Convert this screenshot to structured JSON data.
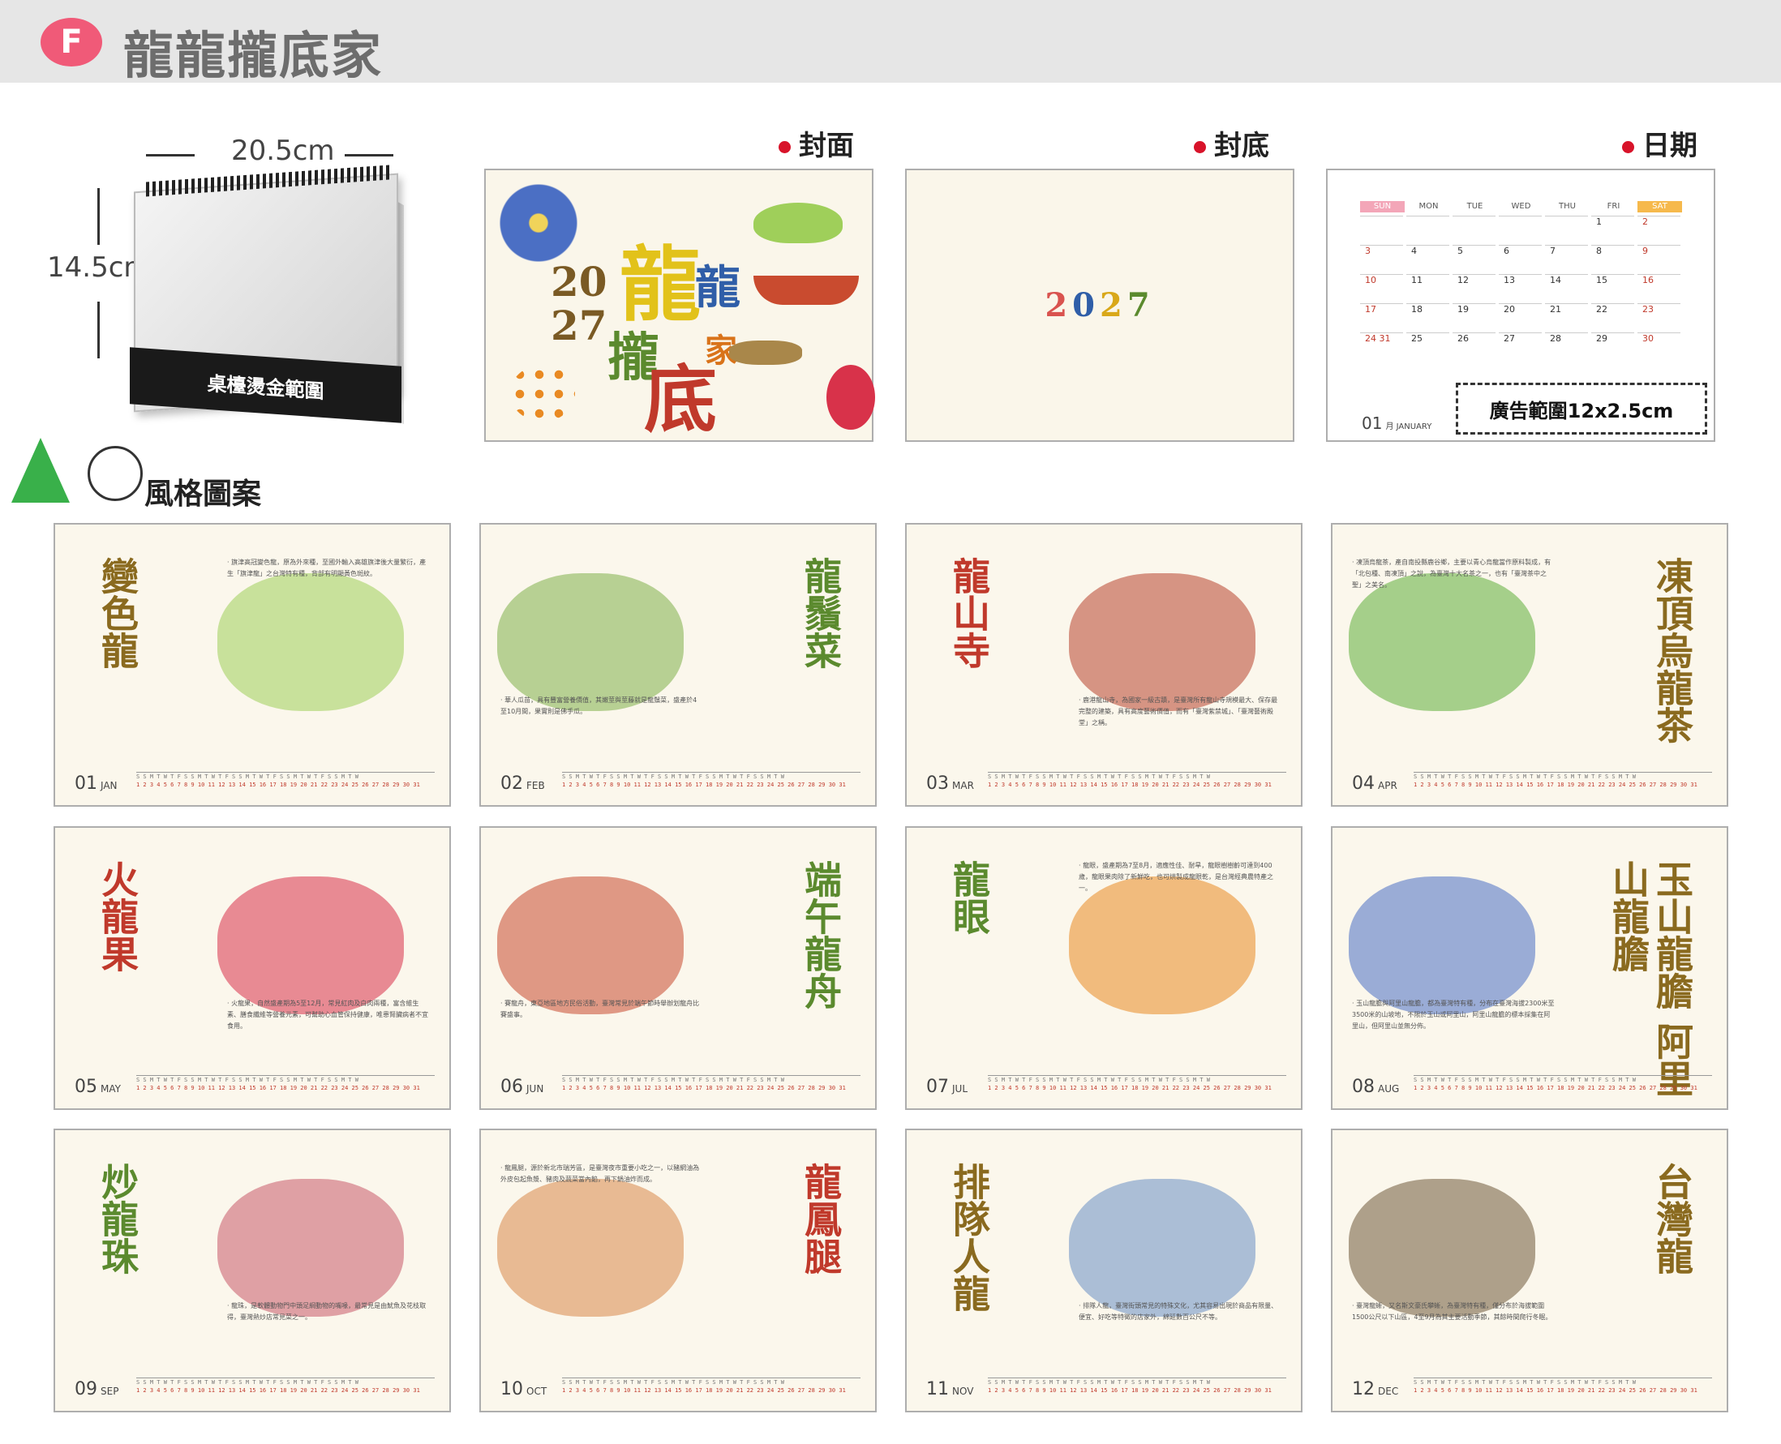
{
  "header": {
    "badge": "F",
    "title": "龍龍攏底家"
  },
  "desk": {
    "width_label": "20.5cm",
    "height_label": "14.5cm",
    "foot_label": "桌檯燙金範圍"
  },
  "sections": {
    "cover": "封面",
    "back": "封底",
    "date": "日期"
  },
  "cover": {
    "year_top": "20",
    "year_bottom": "27",
    "chars": [
      "龍",
      "龍",
      "家",
      "攏",
      "底"
    ]
  },
  "back": {
    "year_digits": [
      "2",
      "0",
      "2",
      "7"
    ]
  },
  "date_page": {
    "weekdays": [
      "SUN",
      "MON",
      "TUE",
      "WED",
      "THU",
      "FRI",
      "SAT"
    ],
    "weeks": [
      [
        "",
        "",
        "",
        "",
        "",
        "1",
        "2"
      ],
      [
        "3",
        "4",
        "5",
        "6",
        "7",
        "8",
        "9"
      ],
      [
        "10",
        "11",
        "12",
        "13",
        "14",
        "15",
        "16"
      ],
      [
        "17",
        "18",
        "19",
        "20",
        "21",
        "22",
        "23"
      ],
      [
        "24 31",
        "25",
        "26",
        "27",
        "28",
        "29",
        "30"
      ]
    ],
    "month_num": "01",
    "month_suffix": "月 JANUARY",
    "ad_label": "廣告範圍12x2.5cm"
  },
  "style_label": "風格圖案",
  "months": [
    {
      "num": "01",
      "abbr": "JAN",
      "title": "變色龍",
      "note": "‧ 旗津高冠變色龍，原為外來種，至國外輸入高雄旗津後大量繁衍，產生「旗津龍」之台灣特有種，背部有明顯黃色斑紋。"
    },
    {
      "num": "02",
      "abbr": "FEB",
      "title": "龍鬚菜",
      "note": "‧ 華人瓜苗，具有豐富營養價值，其嫩莖與莖藤就是龍鬚菜，盛產於4至10月間，果實則是佛手瓜。"
    },
    {
      "num": "03",
      "abbr": "MAR",
      "title": "龍山寺",
      "note": "‧ 鹿港龍山寺，為國家一級古蹟，是臺灣所有龍山寺規模最大、保存最完整的建築，具有高度藝術價值，而有「臺灣紫禁城」、「臺灣藝術殿堂」之稱。"
    },
    {
      "num": "04",
      "abbr": "APR",
      "title": "凍頂烏龍茶",
      "note": "‧ 凍頂烏龍茶，產自南投縣鹿谷鄉，主要以青心烏龍當作原料製成，有「北包種、南凍頂」之說，為臺灣十大名茶之一，也有「臺灣茶中之聖」之美名。"
    },
    {
      "num": "05",
      "abbr": "MAY",
      "title": "火龍果",
      "note": "‧ 火龍果，自然盛產期為5至12月，常見紅肉及白肉兩種，富含維生素、膳食纖維等營養元素，可幫助心血管保持健康，唯患腎臟病者不宜食用。"
    },
    {
      "num": "06",
      "abbr": "JUN",
      "title": "端午龍舟",
      "note": "‧ 賽龍舟，東亞地區地方民俗活動，臺灣常見於端午節時舉辦划龍舟比賽盛事。"
    },
    {
      "num": "07",
      "abbr": "JUL",
      "title": "龍眼",
      "note": "‧ 龍眼，盛產期為7至8月，適應性佳、耐旱，龍眼樹樹齡可達到400歲，龍眼果肉除了新鮮吃，也可烘製成龍眼乾，是台灣經典農特產之一。"
    },
    {
      "num": "08",
      "abbr": "AUG",
      "title": "玉山龍膽 阿里山龍膽",
      "note": "‧ 玉山龍膽與阿里山龍膽，都為臺灣特有種，分布在臺灣海拔2300米至3500米的山坡地，不限於玉山或阿里山，阿里山龍膽的標本採集在阿里山，但阿里山並無分佈。"
    },
    {
      "num": "09",
      "abbr": "SEP",
      "title": "炒龍珠",
      "note": "‧ 龍珠，是軟體動物門中頭足綱動物的嘴喙，最常見是由魷魚及花枝取得，臺灣熱炒店常見菜之一。"
    },
    {
      "num": "10",
      "abbr": "OCT",
      "title": "龍鳳腿",
      "note": "‧ 龍鳳腿，源於新北市瑞芳區，是臺灣夜市重要小吃之一，以豬網油為外皮包起魚漿、豬肉及蔬菜當內餡，再下鍋油炸而成。"
    },
    {
      "num": "11",
      "abbr": "NOV",
      "title": "排隊人龍",
      "note": "‧ 排隊人龍，臺灣街頭常見的特殊文化，尤其容易出現於商品有限量、便宜、好吃等特徵的店家外，綿延數百公尺不等。"
    },
    {
      "num": "12",
      "abbr": "DEC",
      "title": "台灣龍",
      "note": "‧ 臺灣龍蜥，又名斯文豪氏攀蜥，為臺灣特有種，僅分布於海拔範圍1500公尺以下山區，4至9月為其主要活動季節，其餘時間爬行冬眠。"
    }
  ],
  "strip_text": "S S M T W T F S S M T W T F S S M T W T F S S M T W T F S S M T W",
  "strip_days": "1 2 3 4 5 6 7 8 9 10 11 12 13 14 15 16 17 18 19 20 21 22 23 24 25 26 27 28 29 30 31",
  "colors": {
    "badge": "#f05a78",
    "accent_red": "#d8132a",
    "title_green": "#5b8a2e",
    "title_olive": "#8a6a1f",
    "title_red": "#c0392b",
    "title_blue": "#2f5ea8",
    "title_orange": "#d9731a",
    "title_yellow": "#c9a800"
  },
  "cover_char_colors": [
    "#e2c21a",
    "#2f5ea8",
    "#d9731a",
    "#5b8a2e",
    "#c0392b"
  ],
  "back_year_colors": [
    "#d9534f",
    "#2f5ea8",
    "#d9a81a",
    "#5b8a2e"
  ]
}
